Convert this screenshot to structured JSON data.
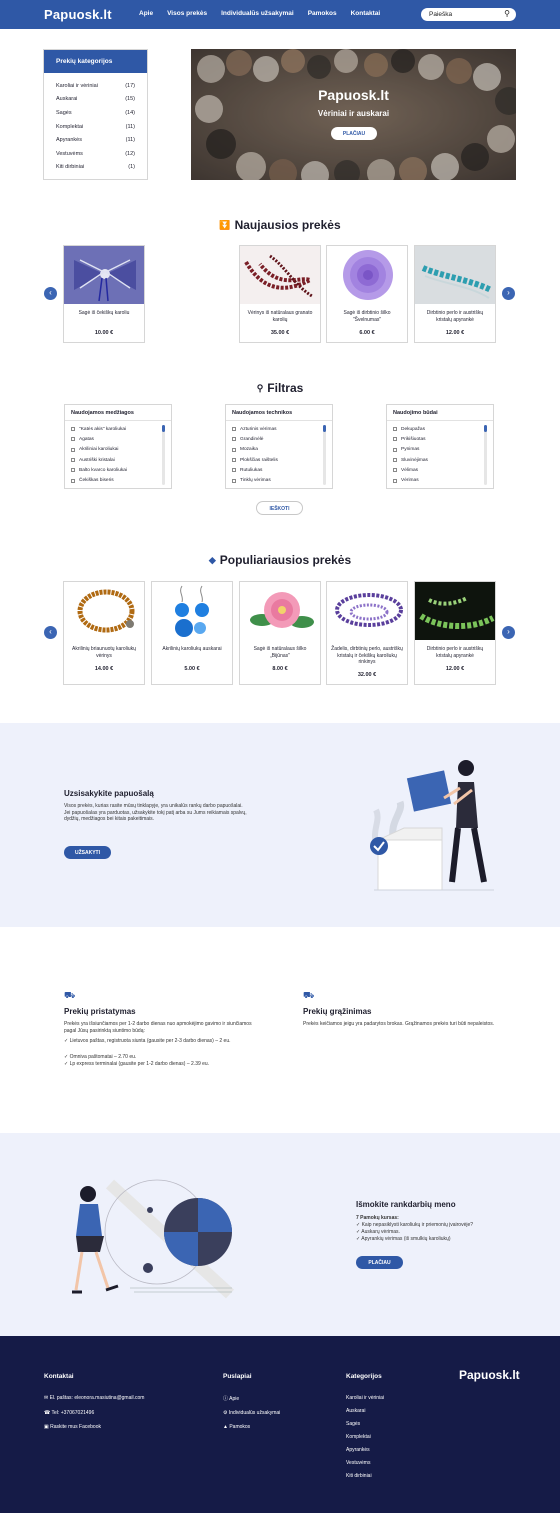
{
  "header": {
    "logo": "Papuosk.lt",
    "nav": [
      "Apie",
      "Visos prekės",
      "Individualūs užsakymai",
      "Pamokos",
      "Kontaktai"
    ],
    "search_placeholder": "Paieška"
  },
  "categories": {
    "title": "Prekių kategorijos",
    "items": [
      {
        "name": "Karoliai ir vėriniai",
        "count": "(17)"
      },
      {
        "name": "Auskarai",
        "count": "(15)"
      },
      {
        "name": "Sagės",
        "count": "(14)"
      },
      {
        "name": "Komplektai",
        "count": "(11)"
      },
      {
        "name": "Apyrankės",
        "count": "(11)"
      },
      {
        "name": "Vestuvėms",
        "count": "(12)"
      },
      {
        "name": "Kiti dirbiniai",
        "count": "(1)"
      }
    ]
  },
  "hero": {
    "title": "Papuosk.lt",
    "subtitle": "Vėriniai ir auskarai",
    "button": "PLAČIAU"
  },
  "newest": {
    "title": "Naujausios prekės",
    "items": [
      {
        "name": "Sagė iš čekiškų karoliu",
        "price": "10.00 €"
      },
      {
        "name": "Vėrinys iš natūralaus granato karolių",
        "price": "35.00 €"
      },
      {
        "name": "Sagė iš dirbtinio šilko \"Švelnumas\"",
        "price": "6.00 €"
      },
      {
        "name": "Dirbtinio perlo ir austriškų kristalų apyrankė",
        "price": "12.00 €"
      }
    ]
  },
  "filter": {
    "title": "Filtras",
    "button": "IEŠKOTI",
    "groups": [
      {
        "title": "Naudojamos medžiagos",
        "items": [
          "\"Katės akis\" karoliukai",
          "Agatas",
          "Akriliniai karoliukai",
          "Austriški kristalai",
          "Balto kvarco karoliukai",
          "Čekiškas biseris"
        ]
      },
      {
        "title": "Naudojamos technikos",
        "items": [
          "Azturinis vėrimas",
          "Grandinėlė",
          "Mozaika",
          "Plokščias raištelis",
          "Rutuliukas",
          "Tinklų vėrimas"
        ]
      },
      {
        "title": "Naudojimo būdai",
        "items": [
          "Dekupažas",
          "Prikišiuotas",
          "Pynimas",
          "Sluvinėjimas",
          "Vėlimas",
          "Vėrimas"
        ]
      }
    ]
  },
  "popular": {
    "title": "Populiariausios prekės",
    "items": [
      {
        "name": "Akrilinių briaunuotų karoliukų vėrinys",
        "price": "14.00 €"
      },
      {
        "name": "Akrilinių karoliukų auskarai",
        "price": "5.00 €"
      },
      {
        "name": "Sagė iš natūralaus šilko „Bijūnas\"",
        "price": "8.00 €"
      },
      {
        "name": "Žadelis, dirbtinių perlo, austriškų kristalų ir čekiškų karoliukų rinkinys",
        "price": "32.00 €"
      },
      {
        "name": "Dirbtinio perlo ir austriškų kristalų apyrankė",
        "price": "12.00 €"
      }
    ]
  },
  "order": {
    "title": "Uzsisakykite papuošalą",
    "text": "Visos prekės, kurias rasite mūsų tinklapyje, yra unikalūs rankų darbo papuošalai. Jei papuošalas yra parduotas, užsakykite tokį patį arba su Jums reikiamais spalvų, dydžių, medžiagos bei kitais pakeitimais.",
    "button": "UŽSAKYTI"
  },
  "delivery": {
    "title": "Prekių pristatymas",
    "text": "Prekės yra išsiunčiamos per 1-2 darbo dienas nuo apmokėjimo gavimo ir siunčiamos pagal Jūsų pasirinktą siuntimo būdą:",
    "items": [
      "✓ Lietuvos paštas, registruota siunta (gausite per 2-3 darbo dienas) – 2 eu.",
      "✓ Omniva paštomatai – 2.70 eu.",
      "✓ Lp express terminalai (gausite per 1-2 darbo dienas) – 2.39 eu."
    ]
  },
  "returns": {
    "title": "Prekių grąžinimas",
    "text": "Prekės keičiamos jeigu yra padarytos brokas. Grąžinamos prekės turi būti nepaleistos."
  },
  "learn": {
    "title": "Išmokite rankdarbių meno",
    "subtitle": "7 Pamokų kursas:",
    "items": [
      "✓ Kaip nepasiklysti karoliukų ir priemonių įvairovėje?",
      "✓ Auskarų vėrimas.",
      "✓ Apyrankių vėrimas (iš smulkių karoliukų)"
    ],
    "button": "PLAČIAU"
  },
  "footer": {
    "contacts_title": "Kontaktai",
    "contacts": [
      "El. paštas: eleonora.masiutina@gmail.com",
      "Tel: +37067021496",
      "Raskite mus Facebook"
    ],
    "pages_title": "Puslapiai",
    "pages": [
      "Apie",
      "Individualūs užsakymai",
      "Pamokos"
    ],
    "categories_title": "Kategorijos",
    "categories": [
      "Karoliai ir vėriniai",
      "Auskarai",
      "Sagės",
      "Komplektai",
      "Apyrankės",
      "Vestuvėms",
      "Kiti dirbiniai"
    ],
    "logo": "Papuosk.lt"
  },
  "colors": {
    "primary": "#2f58a6",
    "footer": "#151b47",
    "band": "#eef1fb"
  }
}
